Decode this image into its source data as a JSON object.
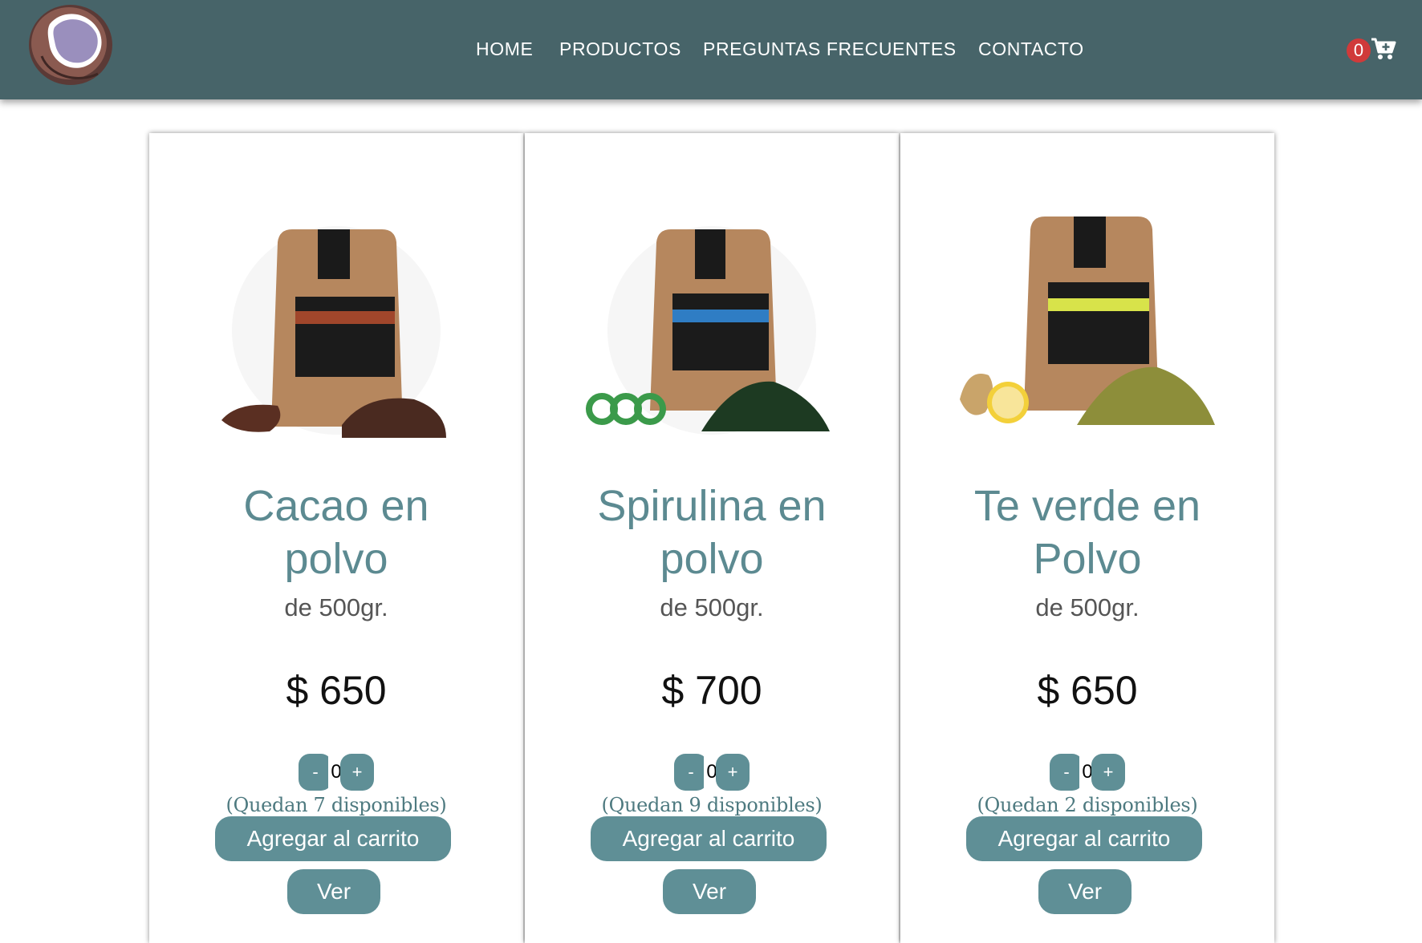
{
  "colors": {
    "navbar_bg": "#476469",
    "accent": "#5f8f96",
    "product_title": "#5c8a91",
    "badge": "#d03a3a"
  },
  "header": {
    "logo": "coconut-logo",
    "nav": {
      "home": "HOME",
      "productos": "PRODUCTOS",
      "faq": "PREGUNTAS FRECUENTES",
      "contacto": "CONTACTO"
    },
    "cart": {
      "count": "0",
      "icon": "cart-plus-icon"
    }
  },
  "products": [
    {
      "name_line1": "Cacao en",
      "name_line2": "polvo",
      "size": "de 500gr.",
      "price": "$ 650",
      "quantity": "0",
      "minus_label": "-",
      "plus_label": "+",
      "stock": "(Quedan 7 disponibles)",
      "add_label": "Agregar al carrito",
      "view_label": "Ver",
      "image": "cacao-pouch-image"
    },
    {
      "name_line1": "Spirulina en",
      "name_line2": "polvo",
      "size": "de 500gr.",
      "price": "$ 700",
      "quantity": "0",
      "minus_label": "-",
      "plus_label": "+",
      "stock": "(Quedan 9 disponibles)",
      "add_label": "Agregar al carrito",
      "view_label": "Ver",
      "image": "spirulina-pouch-image"
    },
    {
      "name_line1": "Te verde en",
      "name_line2": "Polvo",
      "size": "de 500gr.",
      "price": "$ 650",
      "quantity": "0",
      "minus_label": "-",
      "plus_label": "+",
      "stock": "(Quedan 2 disponibles)",
      "add_label": "Agregar al carrito",
      "view_label": "Ver",
      "image": "matcha-pouch-image"
    }
  ]
}
